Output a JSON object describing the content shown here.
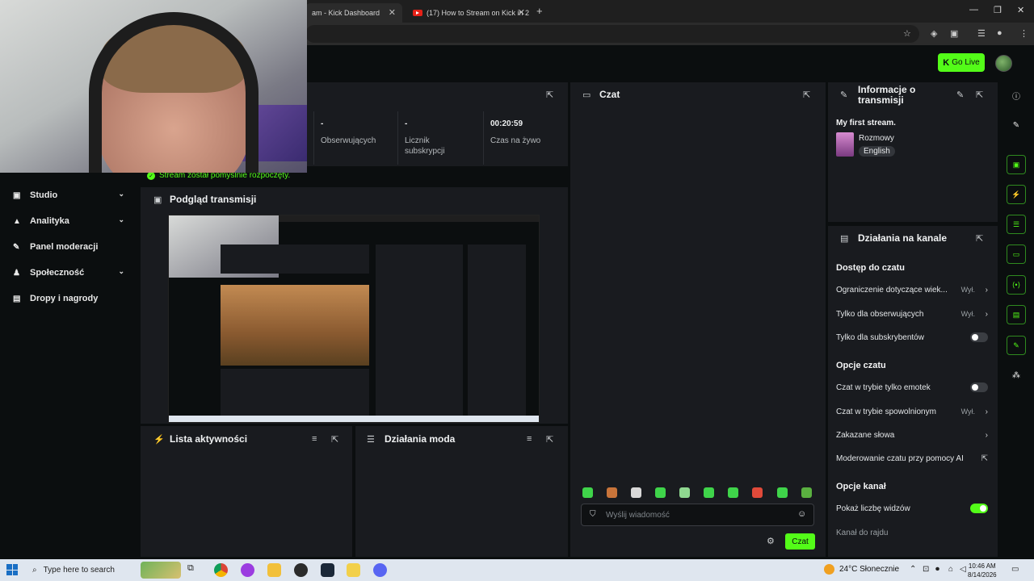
{
  "browser": {
    "tabs": [
      {
        "label": "am - Kick Dashboard"
      },
      {
        "label": "(17) How to Stream on Kick in 2"
      }
    ]
  },
  "header": {
    "go_live": "Go Live"
  },
  "sidebar": {
    "items": [
      {
        "label": "Studio",
        "icon": "studio-icon",
        "expandable": true
      },
      {
        "label": "Analityka",
        "icon": "analytics-icon",
        "expandable": true
      },
      {
        "label": "Panel moderacji",
        "icon": "wrench-icon",
        "expandable": false
      },
      {
        "label": "Społeczność",
        "icon": "community-icon",
        "expandable": true
      },
      {
        "label": "Dropy i nagrody",
        "icon": "gift-icon",
        "expandable": false
      }
    ]
  },
  "stats": [
    {
      "value": "-",
      "label": "Obserwujących"
    },
    {
      "value": "-",
      "label": "Licznik subskrypcji"
    },
    {
      "value": "00:20:59",
      "label": "Czas na żywo"
    }
  ],
  "status": {
    "stream_started": "Stream został pomyślnie rozpoczęty."
  },
  "preview": {
    "title": "Podgląd transmisji"
  },
  "activity": {
    "title": "Lista aktywności"
  },
  "mod_actions": {
    "title": "Działania moda"
  },
  "chat": {
    "title": "Czat",
    "input_placeholder": "Wyślij wiadomość",
    "send_label": "Czat"
  },
  "stream_info": {
    "title": "Informacje o transmisji",
    "stream_title": "My first stream.",
    "category": "Rozmowy",
    "language": "English"
  },
  "channel_actions": {
    "title": "Działania na kanale",
    "sections": {
      "chat_access": "Dostęp do czatu",
      "chat_options": "Opcje czatu",
      "channel_options": "Opcje kanał"
    },
    "rows": {
      "age_restriction": {
        "label": "Ograniczenie dotyczące wiek...",
        "value": "Wył."
      },
      "followers_only": {
        "label": "Tylko dla obserwujących",
        "value": "Wył."
      },
      "subscribers_only": {
        "label": "Tylko dla subskrybentów",
        "enabled": false
      },
      "emote_only": {
        "label": "Czat w trybie tylko emotek",
        "enabled": false
      },
      "slow_mode": {
        "label": "Czat w trybie spowolnionym",
        "value": "Wył."
      },
      "banned_words": {
        "label": "Zakazane słowa"
      },
      "ai_moderation": {
        "label": "Moderowanie czatu przy pomocy AI"
      },
      "show_viewers": {
        "label": "Pokaż liczbę widzów",
        "enabled": true
      },
      "raid_channel": {
        "label": "Kanał do rajdu"
      }
    }
  },
  "taskbar": {
    "search_placeholder": "Type here to search",
    "weather": "24°C  Słonecznie",
    "time": "10:46 AM",
    "date": "8/14/2026"
  },
  "colors": {
    "accent": "#53fc18",
    "panel": "#191b1f",
    "background": "#0b0e0f"
  }
}
